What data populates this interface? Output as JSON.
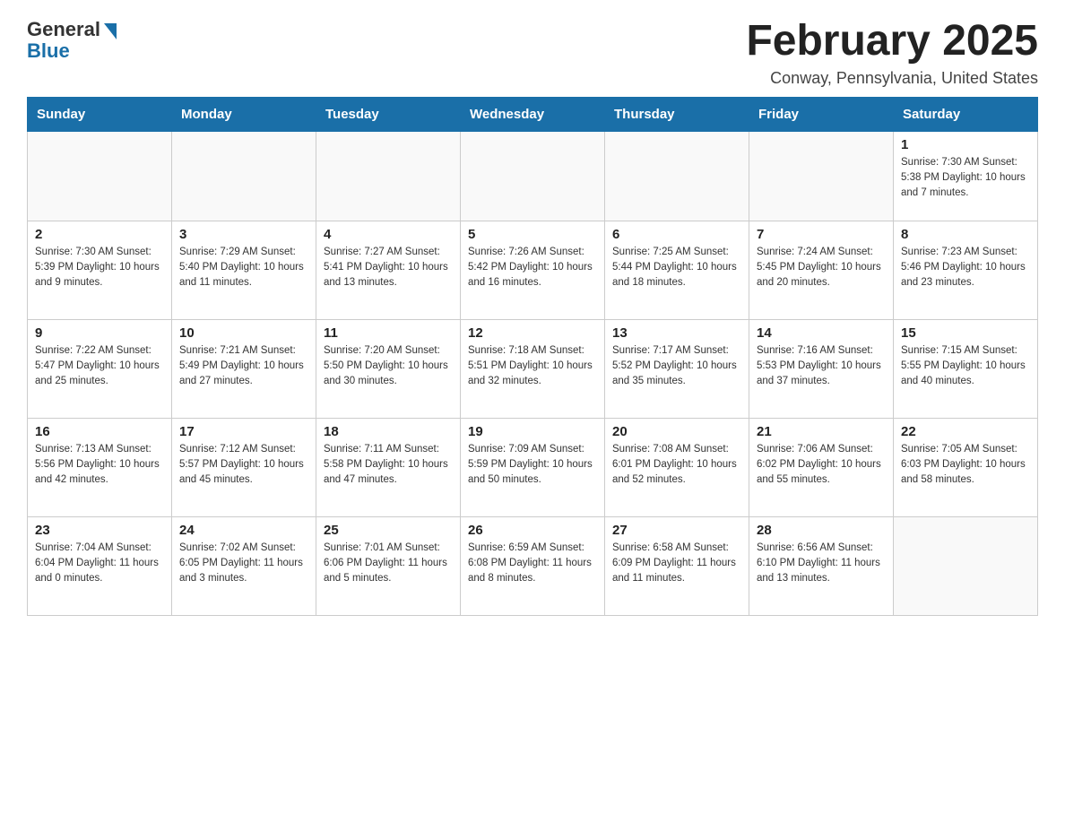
{
  "logo": {
    "general": "General",
    "blue": "Blue"
  },
  "title": "February 2025",
  "location": "Conway, Pennsylvania, United States",
  "weekdays": [
    "Sunday",
    "Monday",
    "Tuesday",
    "Wednesday",
    "Thursday",
    "Friday",
    "Saturday"
  ],
  "weeks": [
    [
      {
        "day": "",
        "info": ""
      },
      {
        "day": "",
        "info": ""
      },
      {
        "day": "",
        "info": ""
      },
      {
        "day": "",
        "info": ""
      },
      {
        "day": "",
        "info": ""
      },
      {
        "day": "",
        "info": ""
      },
      {
        "day": "1",
        "info": "Sunrise: 7:30 AM\nSunset: 5:38 PM\nDaylight: 10 hours and 7 minutes."
      }
    ],
    [
      {
        "day": "2",
        "info": "Sunrise: 7:30 AM\nSunset: 5:39 PM\nDaylight: 10 hours and 9 minutes."
      },
      {
        "day": "3",
        "info": "Sunrise: 7:29 AM\nSunset: 5:40 PM\nDaylight: 10 hours and 11 minutes."
      },
      {
        "day": "4",
        "info": "Sunrise: 7:27 AM\nSunset: 5:41 PM\nDaylight: 10 hours and 13 minutes."
      },
      {
        "day": "5",
        "info": "Sunrise: 7:26 AM\nSunset: 5:42 PM\nDaylight: 10 hours and 16 minutes."
      },
      {
        "day": "6",
        "info": "Sunrise: 7:25 AM\nSunset: 5:44 PM\nDaylight: 10 hours and 18 minutes."
      },
      {
        "day": "7",
        "info": "Sunrise: 7:24 AM\nSunset: 5:45 PM\nDaylight: 10 hours and 20 minutes."
      },
      {
        "day": "8",
        "info": "Sunrise: 7:23 AM\nSunset: 5:46 PM\nDaylight: 10 hours and 23 minutes."
      }
    ],
    [
      {
        "day": "9",
        "info": "Sunrise: 7:22 AM\nSunset: 5:47 PM\nDaylight: 10 hours and 25 minutes."
      },
      {
        "day": "10",
        "info": "Sunrise: 7:21 AM\nSunset: 5:49 PM\nDaylight: 10 hours and 27 minutes."
      },
      {
        "day": "11",
        "info": "Sunrise: 7:20 AM\nSunset: 5:50 PM\nDaylight: 10 hours and 30 minutes."
      },
      {
        "day": "12",
        "info": "Sunrise: 7:18 AM\nSunset: 5:51 PM\nDaylight: 10 hours and 32 minutes."
      },
      {
        "day": "13",
        "info": "Sunrise: 7:17 AM\nSunset: 5:52 PM\nDaylight: 10 hours and 35 minutes."
      },
      {
        "day": "14",
        "info": "Sunrise: 7:16 AM\nSunset: 5:53 PM\nDaylight: 10 hours and 37 minutes."
      },
      {
        "day": "15",
        "info": "Sunrise: 7:15 AM\nSunset: 5:55 PM\nDaylight: 10 hours and 40 minutes."
      }
    ],
    [
      {
        "day": "16",
        "info": "Sunrise: 7:13 AM\nSunset: 5:56 PM\nDaylight: 10 hours and 42 minutes."
      },
      {
        "day": "17",
        "info": "Sunrise: 7:12 AM\nSunset: 5:57 PM\nDaylight: 10 hours and 45 minutes."
      },
      {
        "day": "18",
        "info": "Sunrise: 7:11 AM\nSunset: 5:58 PM\nDaylight: 10 hours and 47 minutes."
      },
      {
        "day": "19",
        "info": "Sunrise: 7:09 AM\nSunset: 5:59 PM\nDaylight: 10 hours and 50 minutes."
      },
      {
        "day": "20",
        "info": "Sunrise: 7:08 AM\nSunset: 6:01 PM\nDaylight: 10 hours and 52 minutes."
      },
      {
        "day": "21",
        "info": "Sunrise: 7:06 AM\nSunset: 6:02 PM\nDaylight: 10 hours and 55 minutes."
      },
      {
        "day": "22",
        "info": "Sunrise: 7:05 AM\nSunset: 6:03 PM\nDaylight: 10 hours and 58 minutes."
      }
    ],
    [
      {
        "day": "23",
        "info": "Sunrise: 7:04 AM\nSunset: 6:04 PM\nDaylight: 11 hours and 0 minutes."
      },
      {
        "day": "24",
        "info": "Sunrise: 7:02 AM\nSunset: 6:05 PM\nDaylight: 11 hours and 3 minutes."
      },
      {
        "day": "25",
        "info": "Sunrise: 7:01 AM\nSunset: 6:06 PM\nDaylight: 11 hours and 5 minutes."
      },
      {
        "day": "26",
        "info": "Sunrise: 6:59 AM\nSunset: 6:08 PM\nDaylight: 11 hours and 8 minutes."
      },
      {
        "day": "27",
        "info": "Sunrise: 6:58 AM\nSunset: 6:09 PM\nDaylight: 11 hours and 11 minutes."
      },
      {
        "day": "28",
        "info": "Sunrise: 6:56 AM\nSunset: 6:10 PM\nDaylight: 11 hours and 13 minutes."
      },
      {
        "day": "",
        "info": ""
      }
    ]
  ]
}
